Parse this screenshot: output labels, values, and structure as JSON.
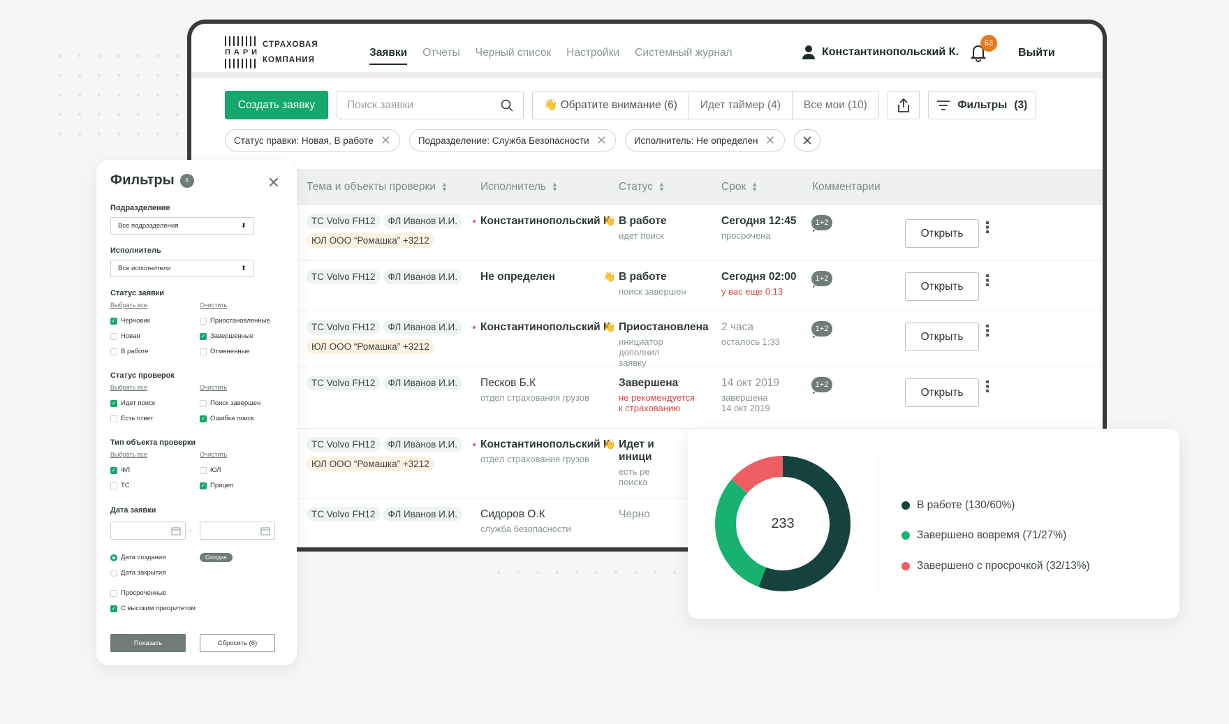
{
  "header": {
    "logo_top": "СТРАХОВАЯ",
    "logo_word": "ПАРИ",
    "logo_bottom": "КОМПАНИЯ",
    "nav": [
      "Заявки",
      "Отчеты",
      "Черный список",
      "Настройки",
      "Системный журнал"
    ],
    "user_name": "Константинопольский К.",
    "notifications": "63",
    "logout": "Выйти"
  },
  "toolbar": {
    "create": "Создать заявку",
    "search_placeholder": "Поиск заявки",
    "seg_attention": "👋 Обратите внимание (6)",
    "seg_timer": "Идет таймер (4)",
    "seg_mine": "Все мои (10)",
    "filters": "Фильтры",
    "filters_count": "(3)"
  },
  "chips": [
    "Статус правки: Новая, В работе",
    "Подразделение: Служба Безопасности",
    "Исполнитель: Не определен"
  ],
  "table": {
    "headers": [
      "Тема и объекты проверки",
      "Исполнитель",
      "Статус",
      "Срок",
      "Комментарии"
    ],
    "rows": [
      {
        "tag1": "ТС Volvo FH12",
        "tag2": "ФЛ Иванов И.И.",
        "tag3": "ЮЛ ООО “Ромашка” +3212",
        "exec": "Константинопольский К.",
        "exec_sub": "",
        "status": "В работе",
        "status_sub": "идет поиск",
        "deadline": "Сегодня 12:45",
        "deadline_sub": "просрочена",
        "comments": "1+2",
        "open": "Открыть"
      },
      {
        "tag1": "ТС Volvo FH12",
        "tag2": "ФЛ Иванов И.И.",
        "tag3": "",
        "exec": "Не определен",
        "exec_sub": "",
        "status": "В работе",
        "status_sub": "поиск завершен",
        "deadline": "Сегодня 02:00",
        "deadline_sub": "у вас еще 0:13",
        "comments": "1+2",
        "open": "Открыть"
      },
      {
        "tag1": "ТС Volvo FH12",
        "tag2": "ФЛ Иванов И.И.",
        "tag3": "ЮЛ ООО “Ромашка” +3212",
        "exec": "Константинопольский К.",
        "exec_sub": "",
        "status": "Приостановлена",
        "status_sub": "инициатор дополнил заявку",
        "deadline": "2 часа",
        "deadline_sub": "осталось 1:33",
        "comments": "1+2",
        "open": "Открыть"
      },
      {
        "tag1": "ТС Volvo FH12",
        "tag2": "ФЛ Иванов И.И.",
        "tag3": "",
        "exec": "Песков Б.К",
        "exec_sub": "отдел страхования грузов",
        "status": "Завершена",
        "status_sub": "не рекомендуется к страхованию",
        "deadline": "14 окт 2019",
        "deadline_sub": "завершена 14 окт 2019",
        "comments": "1+2",
        "open": "Открыть"
      },
      {
        "tag1": "ТС Volvo FH12",
        "tag2": "ФЛ Иванов И.И.",
        "tag3": "ЮЛ ООО “Ромашка” +3212",
        "exec": "Константинопольский К.",
        "exec_sub": "отдел страхования грузов",
        "status": "Идет и",
        "status_line2": "иници",
        "status_sub": "есть ре",
        "status_sub2": "поиска",
        "deadline": "",
        "deadline_sub": "",
        "comments": "",
        "open": ""
      },
      {
        "tag1": "ТС Volvo FH12",
        "tag2": "ФЛ Иванов И.И.",
        "tag3": "",
        "exec": "Сидоров О.К",
        "exec_sub": "служба безопасности",
        "status": "Черно",
        "status_sub": "",
        "deadline": "",
        "deadline_sub": "",
        "comments": "",
        "open": ""
      }
    ]
  },
  "filter_panel": {
    "title": "Фильтры",
    "count": "6",
    "division_label": "Подразделение",
    "division_value": "Все подразделения",
    "executor_label": "Исполнитель",
    "executor_value": "Все исполнители",
    "select_all": "Выбрать все",
    "clear": "Очистить",
    "request_status_label": "Статус заявки",
    "request_status": [
      {
        "label": "Черновик",
        "checked": true
      },
      {
        "label": "Приостановленные",
        "checked": false
      },
      {
        "label": "Новая",
        "checked": false
      },
      {
        "label": "Завершенные",
        "checked": true
      },
      {
        "label": "В работе",
        "checked": false
      },
      {
        "label": "Отмененные",
        "checked": false
      }
    ],
    "check_status_label": "Статус проверок",
    "check_status": [
      {
        "label": "Идет поиск",
        "checked": true
      },
      {
        "label": "Поиск завершен",
        "checked": false
      },
      {
        "label": "Есть ответ",
        "checked": false
      },
      {
        "label": "Ошибка поиск",
        "checked": true
      }
    ],
    "object_type_label": "Тип объекта проверки",
    "object_type": [
      {
        "label": "ФЛ",
        "checked": true
      },
      {
        "label": "ЮЛ",
        "checked": false
      },
      {
        "label": "ТС",
        "checked": false
      },
      {
        "label": "Прицеп",
        "checked": true
      }
    ],
    "date_label": "Дата заявки",
    "date_created": "Дата создания",
    "date_closed": "Дата закрытия",
    "today": "Сегодня",
    "overdue": "Просроченные",
    "high_priority": "С высоким приоритетом",
    "show": "Показать",
    "reset": "Сбросить (6)"
  },
  "chart_data": {
    "type": "pie",
    "total": "233",
    "colors": [
      "#16433f",
      "#17b26f",
      "#ee5e62"
    ],
    "series": [
      {
        "name": "В работе (130/60%)",
        "value": 130
      },
      {
        "name": "Завершено вовремя (71/27%)",
        "value": 71
      },
      {
        "name": "Завершено с просрочкой (32/13%)",
        "value": 32
      }
    ]
  }
}
